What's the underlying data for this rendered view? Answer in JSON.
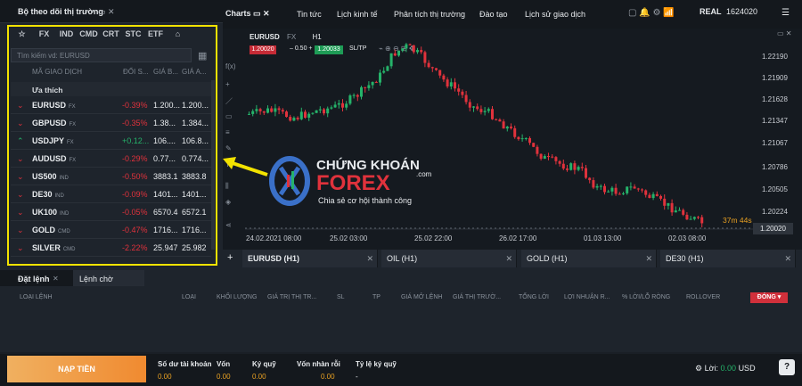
{
  "watchlist": {
    "title": "Bộ theo dõi thị trường",
    "filters": [
      "☆",
      "FX",
      "IND",
      "CMD",
      "CRT",
      "STC",
      "ETF",
      "⌂"
    ],
    "search_placeholder": "Tìm kiếm vd: EURUSD",
    "columns": [
      "MÃ GIAO DỊCH",
      "ĐỔI S...",
      "GIÁ B...",
      "GIÁ A..."
    ],
    "section": "Ưa thích",
    "rows": [
      {
        "symbol": "EURUSD",
        "type": "FX",
        "change": "-0.39%",
        "bid": "1.200...",
        "ask": "1.200...",
        "dir": "down"
      },
      {
        "symbol": "GBPUSD",
        "type": "FX",
        "change": "-0.35%",
        "bid": "1.38...",
        "ask": "1.384...",
        "dir": "down"
      },
      {
        "symbol": "USDJPY",
        "type": "FX",
        "change": "+0.12...",
        "bid": "106....",
        "ask": "106.8...",
        "dir": "up"
      },
      {
        "symbol": "AUDUSD",
        "type": "FX",
        "change": "-0.29%",
        "bid": "0.77...",
        "ask": "0.774...",
        "dir": "down"
      },
      {
        "symbol": "US500",
        "type": "IND",
        "change": "-0.50%",
        "bid": "3883.1",
        "ask": "3883.8",
        "dir": "down"
      },
      {
        "symbol": "DE30",
        "type": "IND",
        "change": "-0.09%",
        "bid": "1401...",
        "ask": "1401...",
        "dir": "down"
      },
      {
        "symbol": "UK100",
        "type": "IND",
        "change": "-0.05%",
        "bid": "6570.4",
        "ask": "6572.1",
        "dir": "down"
      },
      {
        "symbol": "GOLD",
        "type": "CMD",
        "change": "-0.47%",
        "bid": "1716...",
        "ask": "1716...",
        "dir": "down"
      },
      {
        "symbol": "SILVER",
        "type": "CMD",
        "change": "-2.22%",
        "bid": "25.947",
        "ask": "25.982",
        "dir": "down"
      }
    ]
  },
  "topnav": {
    "charts": "Charts",
    "tabs": [
      "Tin tức",
      "Lịch kinh tế",
      "Phân tích thị trường",
      "Đào tạo",
      "Lịch sử giao dịch"
    ],
    "account_type": "REAL",
    "account_id": "1624020"
  },
  "chart": {
    "symbol": "EURUSD",
    "symbol_type": "FX",
    "timeframe": "H1",
    "sell_price": "1.20020",
    "lot": "0.50",
    "buy_price": "1.20033",
    "sltp": "SL/TP",
    "y_ticks": [
      "1.22190",
      "1.21909",
      "1.21628",
      "1.21347",
      "1.21067",
      "1.20786",
      "1.20505",
      "1.20224"
    ],
    "current_price": "1.20020",
    "timer": "37m 44s",
    "x_ticks": [
      "24.02.2021 08:00",
      "25.02 03:00",
      "25.02 22:00",
      "26.02 17:00",
      "01.03 13:00",
      "02.03 08:00"
    ],
    "colors": {
      "up": "#25b36a",
      "down": "#e0323c"
    }
  },
  "chart_tabs": [
    "EURUSD (H1)",
    "OIL (H1)",
    "GOLD (H1)",
    "DE30 (H1)"
  ],
  "logo": {
    "line1": "CHỨNG KHOÁN",
    "line2": "FOREX",
    "dotcom": ".com",
    "tagline": "Chia sẻ cơ hội thành công"
  },
  "orders": {
    "tabs": [
      "Đặt lệnh",
      "Lệnh chờ"
    ],
    "columns": [
      "LOẠI LỆNH",
      "LOẠI",
      "KHỐI LƯỢNG",
      "GIÁ TRỊ THỊ TR...",
      "SL",
      "TP",
      "GIÁ MỞ LỆNH",
      "GIÁ THỊ TRƯỜ...",
      "TỔNG LỜI",
      "LỢI NHUẬN R...",
      "% LỜI/LỖ RÒNG",
      "ROLLOVER"
    ],
    "close_button": "ĐÓNG"
  },
  "footer": {
    "deposit": "NẠP TIỀN",
    "balance_label": "Số dư tài khoản",
    "balance": "0.00",
    "equity_label": "Vốn",
    "equity": "0.00",
    "margin_label": "Ký quỹ",
    "margin": "0.00",
    "free_margin_label": "Vốn nhàn rỗi",
    "free_margin": "0.00",
    "margin_level_label": "Tỷ lệ ký quỹ",
    "margin_level": "-",
    "profit_label": "Lời:",
    "profit": "0.00",
    "currency": "USD",
    "help": "?"
  }
}
